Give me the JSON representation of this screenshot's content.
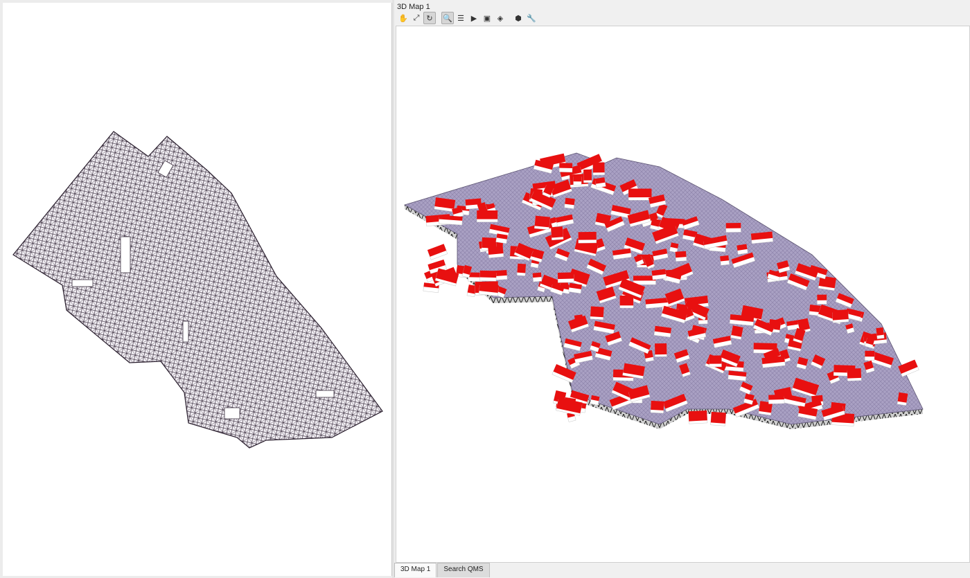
{
  "dock": {
    "title": "3D Map 1",
    "toolbar": [
      {
        "name": "pan-icon",
        "glyph": "✋"
      },
      {
        "name": "zoom-full-icon",
        "glyph": "⤢"
      },
      {
        "name": "rotate-icon",
        "glyph": "↻",
        "active": true
      },
      {
        "name": "identify-icon",
        "glyph": "🔍",
        "active": true
      },
      {
        "name": "measure-icon",
        "glyph": "☰"
      },
      {
        "name": "animation-play-icon",
        "glyph": "▶"
      },
      {
        "name": "save-image-icon",
        "glyph": "▣"
      },
      {
        "name": "export-3d-icon",
        "glyph": "◈"
      },
      {
        "name": "camera-icon",
        "glyph": "⬢"
      },
      {
        "name": "configure-icon",
        "glyph": "🔧"
      }
    ]
  },
  "tabs": [
    {
      "label": "3D Map 1",
      "active": true
    },
    {
      "label": "Search QMS",
      "active": false
    }
  ],
  "colors": {
    "mesh_line": "#3b2f3f",
    "terrain": "#a89fc1",
    "roof": "#e81010",
    "wall": "#ffffff"
  }
}
